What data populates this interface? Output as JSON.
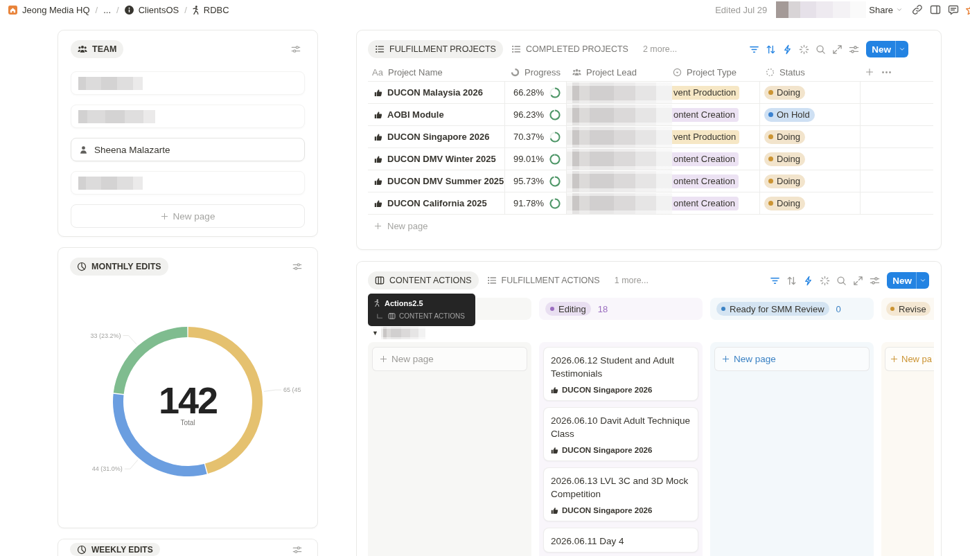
{
  "top_bar": {
    "breadcrumb": [
      {
        "kind": "workspace",
        "label": "Jeong Media HQ"
      },
      {
        "kind": "collapsed",
        "separator": "/",
        "label": "..."
      },
      {
        "kind": "teamspace",
        "separator": "/",
        "label": "ClientsOS"
      },
      {
        "kind": "page",
        "separator": "/",
        "label": "RDBC"
      }
    ],
    "edited": "Edited Jul 29",
    "share": "Share"
  },
  "team": {
    "title": "TEAM",
    "members": [
      {
        "kind": "redacted"
      },
      {
        "kind": "redacted"
      },
      {
        "kind": "person",
        "name": "Sheena Malazarte"
      },
      {
        "kind": "redacted"
      }
    ],
    "new_page": "New page"
  },
  "monthly_edits": {
    "title": "MONTHLY EDITS",
    "total": "142",
    "total_label": "Total",
    "chart_data": {
      "type": "donut",
      "values": [
        65,
        44,
        33
      ],
      "colors": [
        "#e5c16f",
        "#6b9ee0",
        "#7fbc8f"
      ],
      "value_labels": [
        "65 (45",
        "44 (31.0%)",
        "33 (23.2%)"
      ]
    }
  },
  "weekly_edits": {
    "title": "WEEKLY EDITS"
  },
  "fulfillment": {
    "tabs": [
      {
        "kind": "list",
        "label": "FULFILLMENT PROJECTS",
        "selected": true
      },
      {
        "kind": "list",
        "label": "COMPLETED PROJECTS",
        "selected": false
      }
    ],
    "more": "2 more...",
    "toolbar": [
      {
        "kind": "filter",
        "active": true
      },
      {
        "kind": "sort",
        "active": true
      },
      {
        "kind": "automations",
        "active": true
      },
      {
        "kind": "sparkle",
        "active": false
      },
      {
        "kind": "search",
        "active": false
      },
      {
        "kind": "fullscreen",
        "active": false
      },
      {
        "kind": "settings",
        "active": false
      }
    ],
    "new_button": "New",
    "columns": [
      {
        "kind": "title",
        "glyph": "Aa",
        "label": "Project Name"
      },
      {
        "kind": "progress",
        "label": "Progress"
      },
      {
        "kind": "person",
        "label": "Project Lead"
      },
      {
        "kind": "select",
        "label": "Project Type"
      },
      {
        "kind": "status",
        "label": "Status"
      }
    ],
    "rows": [
      {
        "name": "DUCON Malaysia 2026",
        "progress": "66.28%",
        "level": 0.6628,
        "type": {
          "label": "vent Production",
          "color": "#f6e7c5"
        },
        "status": {
          "label": "Doing",
          "color": "#cb9433"
        }
      },
      {
        "name": "AOBI Module",
        "progress": "96.23%",
        "level": 0.9623,
        "type": {
          "label": "ontent Creation",
          "color": "#ece2f3"
        },
        "status": {
          "label": "On Hold",
          "color": "#3b82d0"
        }
      },
      {
        "name": "DUCON Singapore 2026",
        "progress": "70.37%",
        "level": 0.7037,
        "type": {
          "label": "vent Production",
          "color": "#f6e7c5"
        },
        "status": {
          "label": "Doing",
          "color": "#cb9433"
        }
      },
      {
        "name": "DUCON DMV Winter 2025",
        "progress": "99.01%",
        "level": 0.9901,
        "type": {
          "label": "ontent Creation",
          "color": "#ece2f3"
        },
        "status": {
          "label": "Doing",
          "color": "#cb9433"
        }
      },
      {
        "name": "DUCON DMV Summer 2025",
        "progress": "95.73%",
        "level": 0.9573,
        "type": {
          "label": "ontent Creation",
          "color": "#ece2f3"
        },
        "status": {
          "label": "Doing",
          "color": "#cb9433"
        }
      },
      {
        "name": "DUCON California 2025",
        "progress": "91.78%",
        "level": 0.9178,
        "type": {
          "label": "ontent Creation",
          "color": "#ece2f3"
        },
        "status": {
          "label": "Doing",
          "color": "#cb9433"
        }
      }
    ],
    "new_page": "New page"
  },
  "content_actions": {
    "tabs": [
      {
        "kind": "board",
        "label": "CONTENT ACTIONS",
        "selected": true
      },
      {
        "kind": "list",
        "label": "FULFILLMENT ACTIONS",
        "selected": false
      }
    ],
    "more": "1 more...",
    "toolbar": [
      {
        "kind": "filter",
        "active": true
      },
      {
        "kind": "sort",
        "active": false
      },
      {
        "kind": "automations",
        "active": true
      },
      {
        "kind": "sparkle",
        "active": false
      },
      {
        "kind": "search",
        "active": false
      },
      {
        "kind": "fullscreen",
        "active": false
      },
      {
        "kind": "settings",
        "active": false
      }
    ],
    "new_button": "New",
    "tooltip": {
      "title": "Actions2.5",
      "path": "CONTENT ACTIONS"
    },
    "group_toggle": "▼",
    "columns": [
      {
        "new_page": "New page"
      },
      {
        "label": "Editing",
        "count": "18",
        "color": "#9a6dbf",
        "cards": [
          {
            "title": "2026.06.12 Student and Adult Testimonials",
            "project": "DUCON Singapore 2026"
          },
          {
            "title": "2026.06.10 Davit Adult Technique Class",
            "project": "DUCON Singapore 2026"
          },
          {
            "title": "2026.06.13 LVL 3C and 3D Mock Competition",
            "project": "DUCON Singapore 2026"
          },
          {
            "title": "2026.06.11 Day 4"
          }
        ]
      },
      {
        "label": "Ready for SMM Review",
        "count": "0",
        "color": "#3b82c4",
        "new_page": "New page"
      },
      {
        "label": "Revise",
        "color": "#cb9433",
        "new_page": "New pa"
      }
    ]
  }
}
